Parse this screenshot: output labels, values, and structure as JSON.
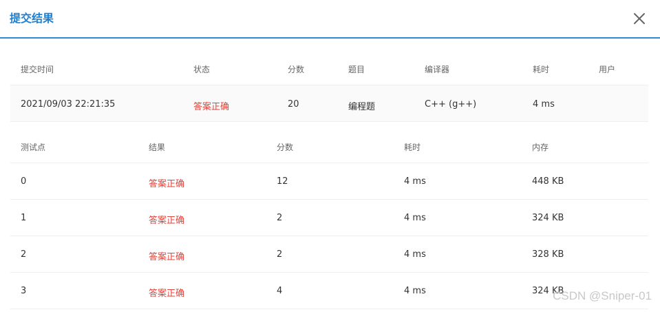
{
  "dialog": {
    "title": "提交结果"
  },
  "submission": {
    "headers": [
      "提交时间",
      "状态",
      "分数",
      "题目",
      "编译器",
      "耗时",
      "用户"
    ],
    "row": {
      "time": "2021/09/03 22:21:35",
      "status": "答案正确",
      "score": "20",
      "problem": "编程题",
      "compiler": "C++ (g++)",
      "duration": "4 ms",
      "user": ""
    }
  },
  "cases": {
    "headers": [
      "测试点",
      "结果",
      "分数",
      "耗时",
      "内存"
    ],
    "rows": [
      {
        "id": "0",
        "result": "答案正确",
        "score": "12",
        "duration": "4 ms",
        "memory": "448 KB"
      },
      {
        "id": "1",
        "result": "答案正确",
        "score": "2",
        "duration": "4 ms",
        "memory": "324 KB"
      },
      {
        "id": "2",
        "result": "答案正确",
        "score": "2",
        "duration": "4 ms",
        "memory": "328 KB"
      },
      {
        "id": "3",
        "result": "答案正确",
        "score": "4",
        "duration": "4 ms",
        "memory": "324 KB"
      }
    ]
  },
  "watermark": "CSDN @Sniper-01",
  "colors": {
    "accent": "#1f7fd1",
    "header_border": "#2e8cd7",
    "status_accepted": "#e0433a"
  },
  "icons": {
    "close": "close-icon"
  }
}
